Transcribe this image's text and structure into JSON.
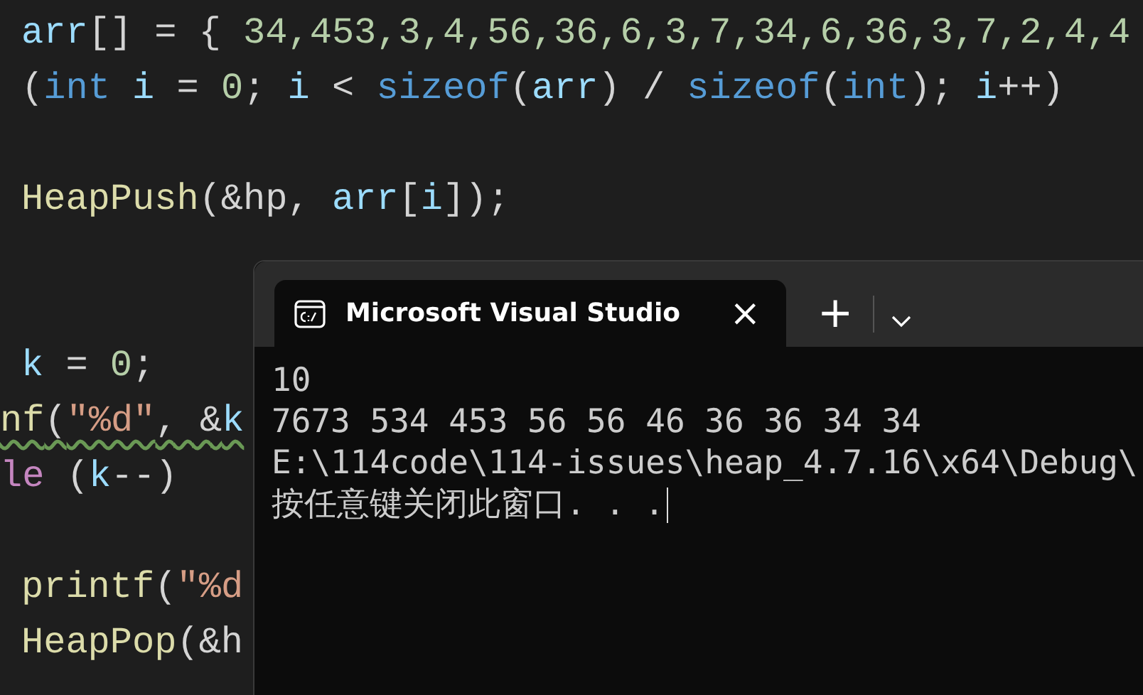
{
  "editor": {
    "lines": [
      {
        "kind": "code",
        "cut_left": false,
        "squiggle": false,
        "tokens": [
          {
            "kind": "ident",
            "text": "arr"
          },
          {
            "kind": "punct",
            "text": "[] = { "
          },
          {
            "kind": "number",
            "text": "34,453,3,4,56,36,6,3,7,34,6,36,3,7,2,4,4"
          }
        ]
      },
      {
        "kind": "code",
        "cut_left": false,
        "squiggle": false,
        "tokens": [
          {
            "kind": "punct",
            "text": "("
          },
          {
            "kind": "keyword",
            "text": "int"
          },
          {
            "kind": "ident",
            "text": " i"
          },
          {
            "kind": "punct",
            "text": " = "
          },
          {
            "kind": "number",
            "text": "0"
          },
          {
            "kind": "punct",
            "text": "; "
          },
          {
            "kind": "ident",
            "text": "i"
          },
          {
            "kind": "punct",
            "text": " < "
          },
          {
            "kind": "keyword",
            "text": "sizeof"
          },
          {
            "kind": "punct",
            "text": "("
          },
          {
            "kind": "ident",
            "text": "arr"
          },
          {
            "kind": "punct",
            "text": ") / "
          },
          {
            "kind": "keyword",
            "text": "sizeof"
          },
          {
            "kind": "punct",
            "text": "("
          },
          {
            "kind": "keyword",
            "text": "int"
          },
          {
            "kind": "punct",
            "text": "); "
          },
          {
            "kind": "ident",
            "text": "i"
          },
          {
            "kind": "punct",
            "text": "++)"
          }
        ]
      },
      {
        "kind": "blank"
      },
      {
        "kind": "code",
        "cut_left": false,
        "squiggle": false,
        "tokens": [
          {
            "kind": "func",
            "text": "HeapPush"
          },
          {
            "kind": "punct",
            "text": "(&hp, "
          },
          {
            "kind": "ident",
            "text": "arr"
          },
          {
            "kind": "punct",
            "text": "["
          },
          {
            "kind": "ident",
            "text": "i"
          },
          {
            "kind": "punct",
            "text": "]);"
          }
        ]
      },
      {
        "kind": "blank"
      },
      {
        "kind": "blank"
      },
      {
        "kind": "code",
        "cut_left": false,
        "squiggle": false,
        "tokens": [
          {
            "kind": "ident",
            "text": "k"
          },
          {
            "kind": "punct",
            "text": " = "
          },
          {
            "kind": "number",
            "text": "0"
          },
          {
            "kind": "punct",
            "text": ";"
          }
        ]
      },
      {
        "kind": "code",
        "cut_left": true,
        "squiggle": true,
        "tokens": [
          {
            "kind": "func",
            "text": "nf"
          },
          {
            "kind": "punct",
            "text": "("
          },
          {
            "kind": "string",
            "text": "\"%d\""
          },
          {
            "kind": "punct",
            "text": ", &"
          },
          {
            "kind": "ident",
            "text": "k"
          }
        ]
      },
      {
        "kind": "code",
        "cut_left": true,
        "squiggle": false,
        "tokens": [
          {
            "kind": "keyword2",
            "text": "le"
          },
          {
            "kind": "punct",
            "text": " ("
          },
          {
            "kind": "ident",
            "text": "k"
          },
          {
            "kind": "punct",
            "text": "--)"
          }
        ]
      },
      {
        "kind": "blank"
      },
      {
        "kind": "code",
        "cut_left": false,
        "squiggle": false,
        "tokens": [
          {
            "kind": "func",
            "text": "printf"
          },
          {
            "kind": "punct",
            "text": "("
          },
          {
            "kind": "string",
            "text": "\"%d"
          }
        ]
      },
      {
        "kind": "code",
        "cut_left": false,
        "squiggle": false,
        "tokens": [
          {
            "kind": "func",
            "text": "HeapPop"
          },
          {
            "kind": "punct",
            "text": "(&h"
          }
        ]
      }
    ]
  },
  "terminal": {
    "tabs": [
      {
        "title": "Microsoft Visual Studio",
        "close": "×",
        "selected": true
      }
    ],
    "new_tab": "+",
    "output": [
      "10",
      "7673 534 453 56 56 46 36 36 34 34",
      "E:\\114code\\114-issues\\heap_4.7.16\\x64\\Debug\\",
      "按任意键关闭此窗口. . ."
    ]
  }
}
